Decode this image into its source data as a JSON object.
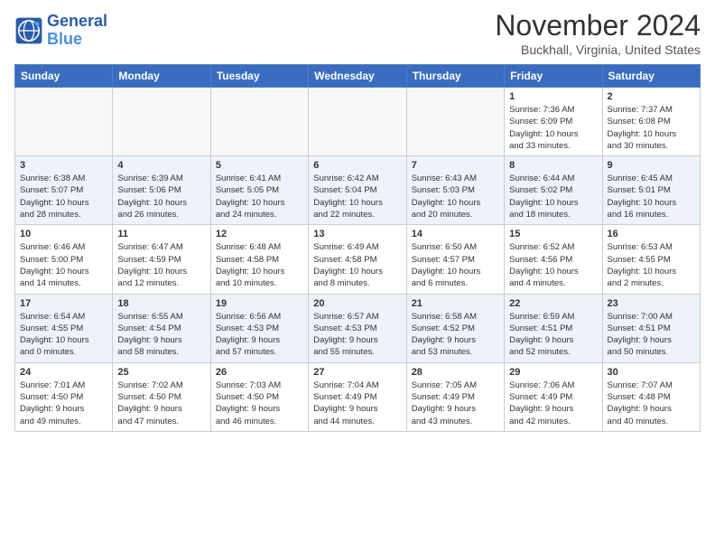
{
  "header": {
    "logo_line1": "General",
    "logo_line2": "Blue",
    "title": "November 2024",
    "subtitle": "Buckhall, Virginia, United States"
  },
  "weekdays": [
    "Sunday",
    "Monday",
    "Tuesday",
    "Wednesday",
    "Thursday",
    "Friday",
    "Saturday"
  ],
  "weeks": [
    [
      {
        "day": "",
        "info": ""
      },
      {
        "day": "",
        "info": ""
      },
      {
        "day": "",
        "info": ""
      },
      {
        "day": "",
        "info": ""
      },
      {
        "day": "",
        "info": ""
      },
      {
        "day": "1",
        "info": "Sunrise: 7:36 AM\nSunset: 6:09 PM\nDaylight: 10 hours\nand 33 minutes."
      },
      {
        "day": "2",
        "info": "Sunrise: 7:37 AM\nSunset: 6:08 PM\nDaylight: 10 hours\nand 30 minutes."
      }
    ],
    [
      {
        "day": "3",
        "info": "Sunrise: 6:38 AM\nSunset: 5:07 PM\nDaylight: 10 hours\nand 28 minutes."
      },
      {
        "day": "4",
        "info": "Sunrise: 6:39 AM\nSunset: 5:06 PM\nDaylight: 10 hours\nand 26 minutes."
      },
      {
        "day": "5",
        "info": "Sunrise: 6:41 AM\nSunset: 5:05 PM\nDaylight: 10 hours\nand 24 minutes."
      },
      {
        "day": "6",
        "info": "Sunrise: 6:42 AM\nSunset: 5:04 PM\nDaylight: 10 hours\nand 22 minutes."
      },
      {
        "day": "7",
        "info": "Sunrise: 6:43 AM\nSunset: 5:03 PM\nDaylight: 10 hours\nand 20 minutes."
      },
      {
        "day": "8",
        "info": "Sunrise: 6:44 AM\nSunset: 5:02 PM\nDaylight: 10 hours\nand 18 minutes."
      },
      {
        "day": "9",
        "info": "Sunrise: 6:45 AM\nSunset: 5:01 PM\nDaylight: 10 hours\nand 16 minutes."
      }
    ],
    [
      {
        "day": "10",
        "info": "Sunrise: 6:46 AM\nSunset: 5:00 PM\nDaylight: 10 hours\nand 14 minutes."
      },
      {
        "day": "11",
        "info": "Sunrise: 6:47 AM\nSunset: 4:59 PM\nDaylight: 10 hours\nand 12 minutes."
      },
      {
        "day": "12",
        "info": "Sunrise: 6:48 AM\nSunset: 4:58 PM\nDaylight: 10 hours\nand 10 minutes."
      },
      {
        "day": "13",
        "info": "Sunrise: 6:49 AM\nSunset: 4:58 PM\nDaylight: 10 hours\nand 8 minutes."
      },
      {
        "day": "14",
        "info": "Sunrise: 6:50 AM\nSunset: 4:57 PM\nDaylight: 10 hours\nand 6 minutes."
      },
      {
        "day": "15",
        "info": "Sunrise: 6:52 AM\nSunset: 4:56 PM\nDaylight: 10 hours\nand 4 minutes."
      },
      {
        "day": "16",
        "info": "Sunrise: 6:53 AM\nSunset: 4:55 PM\nDaylight: 10 hours\nand 2 minutes."
      }
    ],
    [
      {
        "day": "17",
        "info": "Sunrise: 6:54 AM\nSunset: 4:55 PM\nDaylight: 10 hours\nand 0 minutes."
      },
      {
        "day": "18",
        "info": "Sunrise: 6:55 AM\nSunset: 4:54 PM\nDaylight: 9 hours\nand 58 minutes."
      },
      {
        "day": "19",
        "info": "Sunrise: 6:56 AM\nSunset: 4:53 PM\nDaylight: 9 hours\nand 57 minutes."
      },
      {
        "day": "20",
        "info": "Sunrise: 6:57 AM\nSunset: 4:53 PM\nDaylight: 9 hours\nand 55 minutes."
      },
      {
        "day": "21",
        "info": "Sunrise: 6:58 AM\nSunset: 4:52 PM\nDaylight: 9 hours\nand 53 minutes."
      },
      {
        "day": "22",
        "info": "Sunrise: 6:59 AM\nSunset: 4:51 PM\nDaylight: 9 hours\nand 52 minutes."
      },
      {
        "day": "23",
        "info": "Sunrise: 7:00 AM\nSunset: 4:51 PM\nDaylight: 9 hours\nand 50 minutes."
      }
    ],
    [
      {
        "day": "24",
        "info": "Sunrise: 7:01 AM\nSunset: 4:50 PM\nDaylight: 9 hours\nand 49 minutes."
      },
      {
        "day": "25",
        "info": "Sunrise: 7:02 AM\nSunset: 4:50 PM\nDaylight: 9 hours\nand 47 minutes."
      },
      {
        "day": "26",
        "info": "Sunrise: 7:03 AM\nSunset: 4:50 PM\nDaylight: 9 hours\nand 46 minutes."
      },
      {
        "day": "27",
        "info": "Sunrise: 7:04 AM\nSunset: 4:49 PM\nDaylight: 9 hours\nand 44 minutes."
      },
      {
        "day": "28",
        "info": "Sunrise: 7:05 AM\nSunset: 4:49 PM\nDaylight: 9 hours\nand 43 minutes."
      },
      {
        "day": "29",
        "info": "Sunrise: 7:06 AM\nSunset: 4:49 PM\nDaylight: 9 hours\nand 42 minutes."
      },
      {
        "day": "30",
        "info": "Sunrise: 7:07 AM\nSunset: 4:48 PM\nDaylight: 9 hours\nand 40 minutes."
      }
    ]
  ]
}
